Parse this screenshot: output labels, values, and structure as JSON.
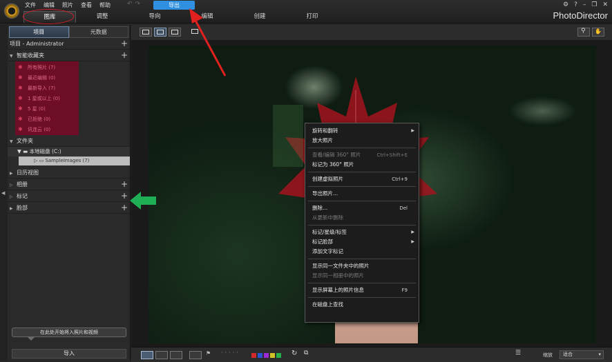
{
  "menu": [
    "文件",
    "编辑",
    "照片",
    "查看",
    "帮助"
  ],
  "export_button": "导出",
  "tabs": [
    {
      "label": "图库",
      "active": true
    },
    {
      "label": "调整",
      "active": false
    },
    {
      "label": "导向",
      "active": false
    },
    {
      "label": "编辑",
      "active": false
    },
    {
      "label": "创建",
      "active": false
    },
    {
      "label": "打印",
      "active": false
    }
  ],
  "brand": "PhotoDirector",
  "window_controls": [
    "⚙",
    "?",
    "–",
    "❐",
    "✕"
  ],
  "left_panel": {
    "tabs": [
      "项目",
      "元数据"
    ],
    "project_header": "项目 - Administrator",
    "smart_collections_header": "智能收藏夹",
    "smart_collections": [
      "所有照片 (7)",
      "最近编辑 (0)",
      "最新导入 (7)",
      "1 星或以上 (0)",
      "5 星 (0)",
      "已拒绝 (0)",
      "讯连云 (0)"
    ],
    "folders_header": "文件夹",
    "disk": "本地磁盘 (C:)",
    "folder": "SampleImages (7)",
    "calendar": "日历视图",
    "albums": "相册",
    "tags": "标记",
    "faces": "脸部",
    "import_hint": "在此处开始将入照片和视频",
    "import_button": "导入"
  },
  "context_menu": [
    {
      "label": "旋转和翻转",
      "submenu": true
    },
    {
      "label": "放大照片"
    },
    {
      "sep": true
    },
    {
      "label": "查看/编辑 360° 照片",
      "shortcut": "Ctrl+Shift+E",
      "disabled": true
    },
    {
      "label": "标记为 360° 照片"
    },
    {
      "sep": true
    },
    {
      "label": "创建虚拟照片",
      "shortcut": "Ctrl+9"
    },
    {
      "sep": true
    },
    {
      "label": "导出照片..."
    },
    {
      "sep": true
    },
    {
      "label": "删除...",
      "shortcut": "Del"
    },
    {
      "label": "从更新中删除",
      "disabled": true
    },
    {
      "sep": true
    },
    {
      "label": "标记/星级/标签",
      "submenu": true
    },
    {
      "label": "标记脸部",
      "submenu": true
    },
    {
      "label": "添加文字标记"
    },
    {
      "sep": true
    },
    {
      "label": "显示同一文件夹中的照片"
    },
    {
      "label": "显示同一相册中的照片",
      "disabled": true
    },
    {
      "sep": true
    },
    {
      "label": "显示屏幕上的照片信息",
      "shortcut": "F9"
    },
    {
      "sep": true
    },
    {
      "label": "在磁盘上查找"
    }
  ],
  "bottom": {
    "zoom_label": "缩放",
    "zoom_value": "适合",
    "colors": [
      "#d22a2a",
      "#2a55d2",
      "#9b2ad2",
      "#d2c22a",
      "#2ab04a"
    ]
  },
  "annotation_colors": {
    "ring": "#d4202a",
    "arrow_red": "#e0211f",
    "arrow_green": "#1fae55"
  }
}
